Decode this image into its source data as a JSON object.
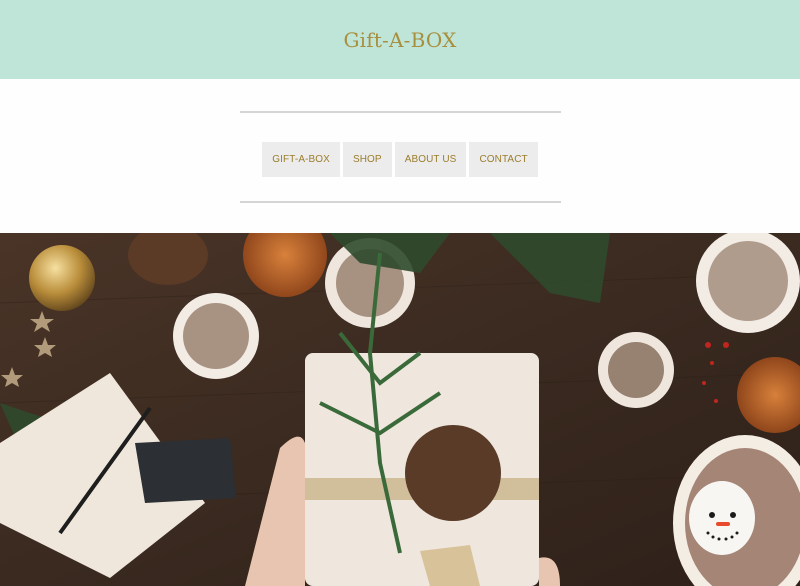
{
  "header": {
    "title": "Gift-A-BOX",
    "bg": "#bfe5d9",
    "title_color": "#a88f3e"
  },
  "nav": {
    "items": [
      {
        "label": "GIFT-A-BOX"
      },
      {
        "label": "SHOP"
      },
      {
        "label": "ABOUT US"
      },
      {
        "label": "CONTACT"
      }
    ],
    "item_bg": "#ececec",
    "item_color": "#9a7d2c"
  },
  "hero": {
    "description_icons": [
      "pine-cone-icon",
      "gift-box-icon",
      "ornament-icon",
      "mug-icon"
    ]
  }
}
